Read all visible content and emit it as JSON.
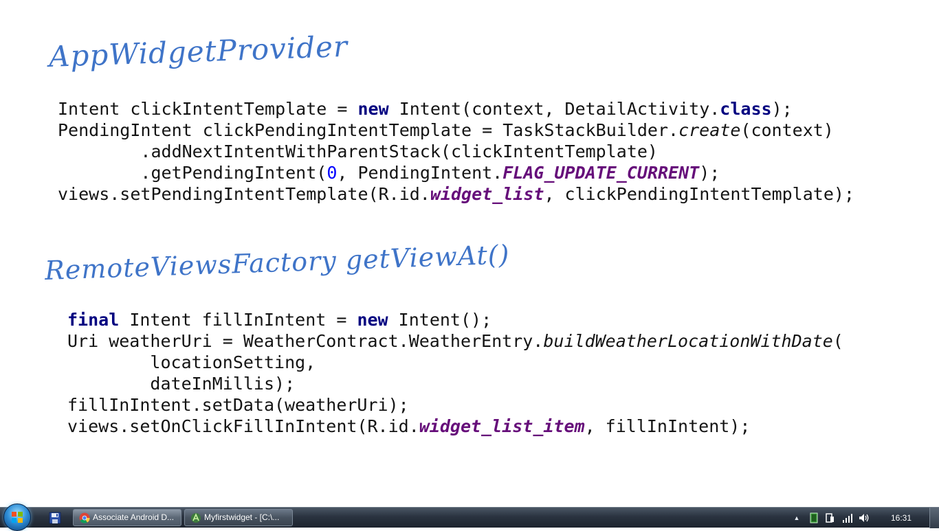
{
  "slide": {
    "handwritten_title_1": "AppWidgetProvider",
    "handwritten_title_2": "RemoteViewsFactory getViewAt()",
    "code_block_1": [
      [
        [
          "Intent clickIntentTemplate = ",
          ""
        ],
        [
          "new",
          "kw"
        ],
        [
          " Intent(context, DetailActivity.",
          ""
        ],
        [
          "class",
          "kw"
        ],
        [
          ");",
          ""
        ]
      ],
      [
        [
          "PendingIntent clickPendingIntentTemplate = TaskStackBuilder.",
          ""
        ],
        [
          "create",
          "it"
        ],
        [
          "(context)",
          ""
        ]
      ],
      [
        [
          "        .addNextIntentWithParentStack(clickIntentTemplate)",
          ""
        ]
      ],
      [
        [
          "        .getPendingIntent(",
          ""
        ],
        [
          "0",
          "num"
        ],
        [
          ", PendingIntent.",
          ""
        ],
        [
          "FLAG_UPDATE_CURRENT",
          "const"
        ],
        [
          ");",
          ""
        ]
      ],
      [
        [
          "views.setPendingIntentTemplate(R.id.",
          ""
        ],
        [
          "widget_list",
          "const"
        ],
        [
          ", clickPendingIntentTemplate);",
          ""
        ]
      ]
    ],
    "code_block_2": [
      [
        [
          "final",
          "kw"
        ],
        [
          " Intent fillInIntent = ",
          ""
        ],
        [
          "new",
          "kw"
        ],
        [
          " Intent();",
          ""
        ]
      ],
      [
        [
          "Uri weatherUri = WeatherContract.WeatherEntry.",
          ""
        ],
        [
          "buildWeatherLocationWithDate",
          "it"
        ],
        [
          "(",
          ""
        ]
      ],
      [
        [
          "        locationSetting,",
          ""
        ]
      ],
      [
        [
          "        dateInMillis);",
          ""
        ]
      ],
      [
        [
          "fillInIntent.setData(weatherUri);",
          ""
        ]
      ],
      [
        [
          "views.setOnClickFillInIntent(R.id.",
          ""
        ],
        [
          "widget_list_item",
          "const"
        ],
        [
          ", fillInIntent);",
          ""
        ]
      ]
    ]
  },
  "taskbar": {
    "tasks": [
      {
        "label": "Associate Android D...",
        "icon": "chrome-icon"
      },
      {
        "label": "Myfirstwidget - [C:\\...",
        "icon": "android-studio-icon"
      }
    ],
    "clock": "16:31",
    "tray_arrow": "▲"
  },
  "colors": {
    "handwriting": "#3f74c8",
    "keyword": "#000080",
    "constant": "#660e7a",
    "number": "#0000ff"
  }
}
